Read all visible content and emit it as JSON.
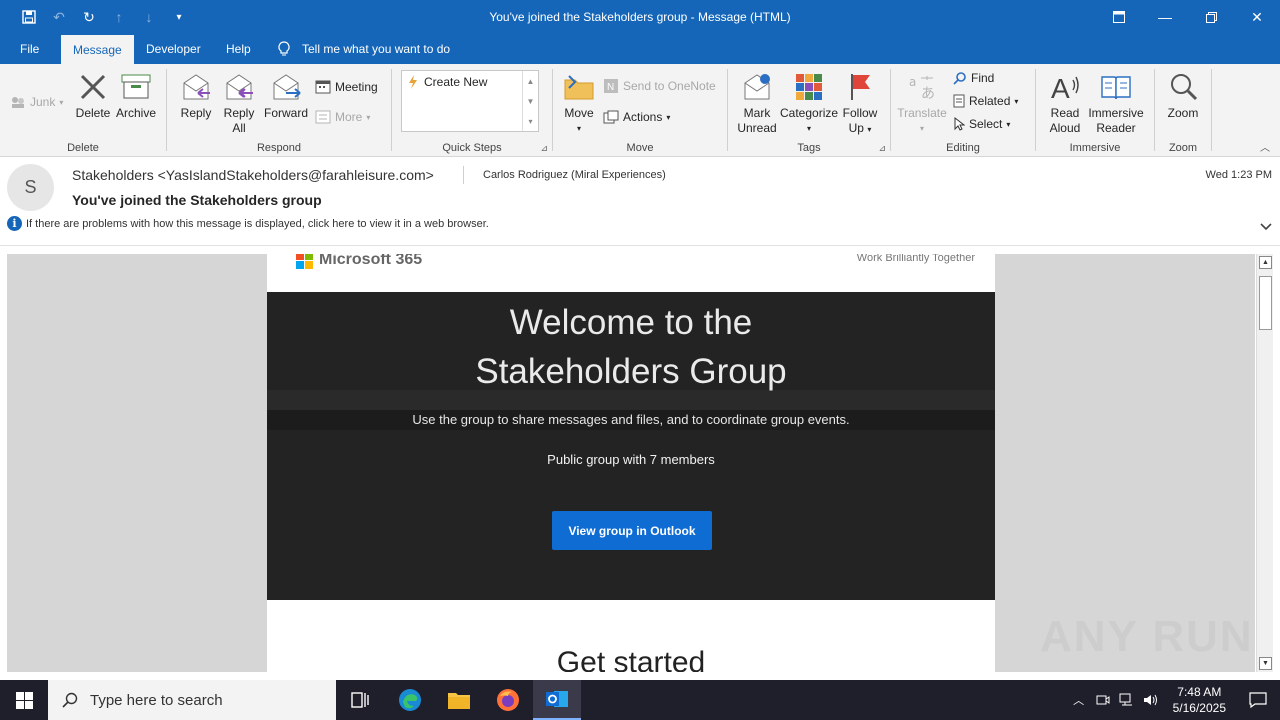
{
  "window": {
    "title": "You've joined the Stakeholders group  -  Message (HTML)"
  },
  "menu": {
    "tabs": [
      "File",
      "Message",
      "Developer",
      "Help"
    ],
    "active_tab": "Message",
    "tell_me": "Tell me what you want to do"
  },
  "ribbon": {
    "groups": {
      "delete": "Delete",
      "respond": "Respond",
      "quick_steps": "Quick Steps",
      "move": "Move",
      "tags": "Tags",
      "editing": "Editing",
      "immersive": "Immersive",
      "zoom": "Zoom"
    },
    "junk": "Junk",
    "delete": "Delete",
    "archive": "Archive",
    "reply": "Reply",
    "reply_all_1": "Reply",
    "reply_all_2": "All",
    "forward": "Forward",
    "meeting": "Meeting",
    "more": "More",
    "create_new": "Create New",
    "move": "Move",
    "send_to_onenote": "Send to OneNote",
    "actions": "Actions",
    "mark_unread_1": "Mark",
    "mark_unread_2": "Unread",
    "categorize": "Categorize",
    "follow_up_1": "Follow",
    "follow_up_2": "Up",
    "translate": "Translate",
    "find": "Find",
    "related": "Related",
    "select": "Select",
    "read_aloud_1": "Read",
    "read_aloud_2": "Aloud",
    "immersive_reader_1": "Immersive",
    "immersive_reader_2": "Reader",
    "zoom": "Zoom"
  },
  "message": {
    "avatar_initial": "S",
    "from": "Stakeholders <YasIslandStakeholders@farahleisure.com>",
    "to": "Carlos Rodriguez (Miral Experiences)",
    "sent": "Wed 1:23 PM",
    "subject": "You've joined the Stakeholders group",
    "info_bar": "If there are problems with how this message is displayed, click here to view it in a web browser."
  },
  "email": {
    "brand": "Microsoft 365",
    "tagline": "Work Brilliantly Together",
    "hero_line1": "Welcome to the",
    "hero_line2": "Stakeholders Group",
    "subtitle": "Use the group to share messages and files, and to coordinate group events.",
    "members": "Public group with 7 members",
    "cta": "View group in Outlook",
    "get_started": "Get started"
  },
  "watermark": "ANY RUN",
  "taskbar": {
    "search_placeholder": "Type here to search",
    "time": "7:48 AM",
    "date": "5/16/2025"
  },
  "colors": {
    "title_bar": "#1566b8",
    "ribbon": "#f3f3f3",
    "hero": "#232323",
    "cta": "#0f6cd3",
    "taskbar": "#1f1f2b"
  }
}
